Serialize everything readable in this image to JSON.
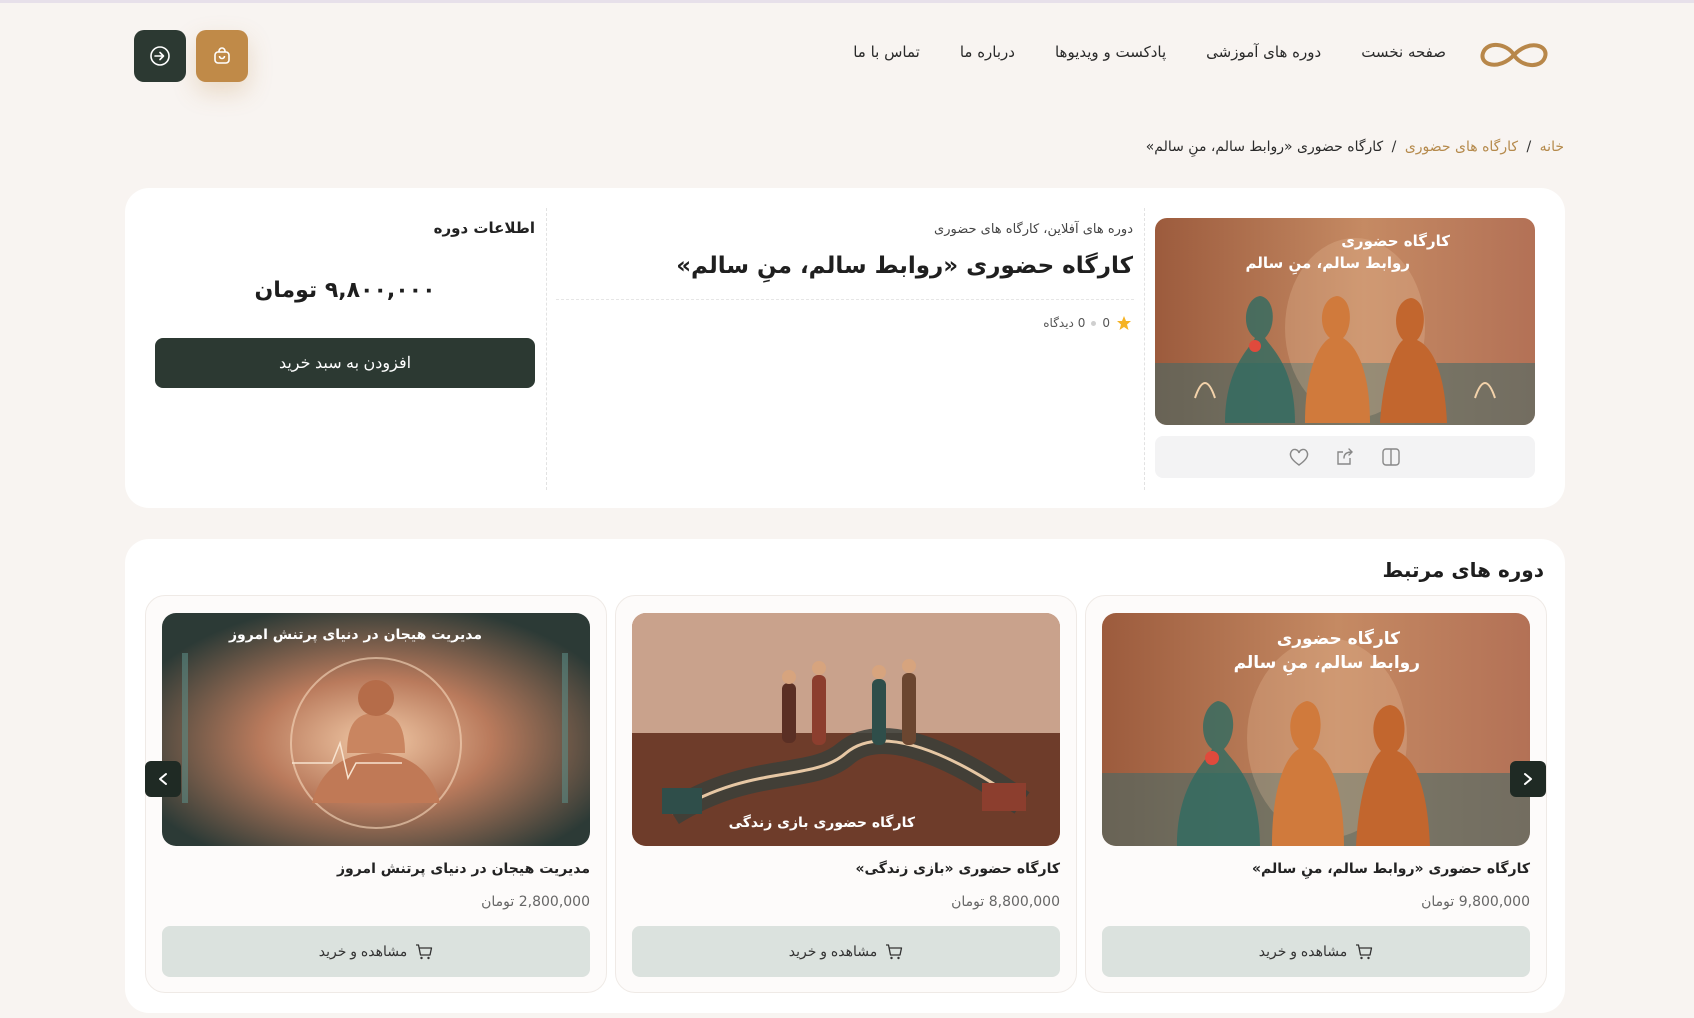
{
  "header": {
    "nav": [
      "صفحه نخست",
      "دوره های آموزشی",
      "پادکست و ویدیوها",
      "درباره ما",
      "تماس با ما"
    ],
    "logo_icon": "infinity-logo",
    "cart_icon": "shopping-bag-icon",
    "login_icon": "login-icon"
  },
  "breadcrumb": {
    "home": "خانه",
    "category": "کارگاه های حضوری",
    "current": "کارگاه حضوری «روابط سالم، منِ سالم»",
    "separator": "/"
  },
  "product": {
    "image_title_line1": "کارگاه حضوری",
    "image_title_line2": "روابط سالم، منِ سالم",
    "categories": "دوره های آفلاین، کارگاه های حضوری",
    "title": "کارگاه حضوری «روابط سالم، منِ سالم»",
    "rating": "0",
    "reviews": "0 دیدگاه",
    "info_title": "اطلاعات دوره",
    "price": "۹,۸۰۰,۰۰۰ تومان",
    "add_to_cart": "افزودن به سبد خرید",
    "tools": [
      "heart-icon",
      "share-icon",
      "compare-icon"
    ]
  },
  "related": {
    "title": "دوره های مرتبط",
    "courses": [
      {
        "image_text_line1": "کارگاه حضوری",
        "image_text_line2": "روابط سالم، منِ سالم",
        "name": "کارگاه حضوری «روابط سالم، منِ سالم»",
        "price": "9,800,000 تومان",
        "button": "مشاهده و خرید"
      },
      {
        "image_text_line1": "کارگاه حضوری بازی زندگی",
        "name": "کارگاه حضوری «بازی زندگی»",
        "price": "8,800,000 تومان",
        "button": "مشاهده و خرید"
      },
      {
        "image_text_line1": "مدیریت هیجان در دنیای پرتنش امروز",
        "name": "مدیریت هیجان در دنیای پرتنش امروز",
        "price": "2,800,000 تومان",
        "button": "مشاهده و خرید"
      }
    ]
  },
  "colors": {
    "accent": "#c08a48",
    "dark": "#2c3932",
    "background": "#f8f4f1",
    "soft_button": "#dbe2de"
  }
}
